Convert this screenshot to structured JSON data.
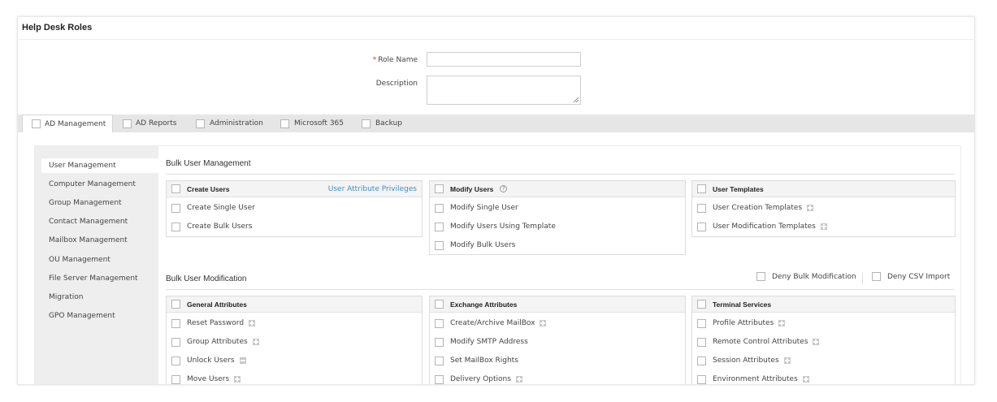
{
  "title": "Help Desk Roles",
  "form": {
    "role_name_required_mark": "*",
    "role_name_label": "Role Name",
    "role_name_value": "",
    "description_label": "Description",
    "description_value": ""
  },
  "tabs": [
    {
      "label": "AD Management",
      "active": true
    },
    {
      "label": "AD Reports",
      "active": false
    },
    {
      "label": "Administration",
      "active": false
    },
    {
      "label": "Microsoft 365",
      "active": false
    },
    {
      "label": "Backup",
      "active": false
    }
  ],
  "sidebar": {
    "items": [
      {
        "label": "User Management",
        "active": true
      },
      {
        "label": "Computer Management",
        "active": false
      },
      {
        "label": "Group Management",
        "active": false
      },
      {
        "label": "Contact Management",
        "active": false
      },
      {
        "label": "Mailbox Management",
        "active": false
      },
      {
        "label": "OU Management",
        "active": false
      },
      {
        "label": "File Server Management",
        "active": false
      },
      {
        "label": "Migration",
        "active": false
      },
      {
        "label": "GPO Management",
        "active": false
      }
    ]
  },
  "bulk_user_management": {
    "title": "Bulk User Management",
    "create_users": {
      "header": "Create Users",
      "link": "User Attribute Privileges",
      "rows": [
        "Create Single User",
        "Create Bulk Users"
      ]
    },
    "modify_users": {
      "header": "Modify Users",
      "help_icon": "?",
      "rows": [
        "Modify Single User",
        "Modify Users Using Template",
        "Modify Bulk Users"
      ]
    },
    "user_templates": {
      "header": "User Templates",
      "rows": [
        "User Creation Templates",
        "User Modification Templates"
      ]
    }
  },
  "bulk_user_modification": {
    "title": "Bulk User Modification",
    "deny_bulk_label": "Deny Bulk Modification",
    "deny_csv_label": "Deny CSV Import",
    "general_attributes": {
      "header": "General Attributes",
      "rows": [
        "Reset Password",
        "Group Attributes",
        "Unlock Users",
        "Move Users"
      ]
    },
    "exchange_attributes": {
      "header": "Exchange Attributes",
      "rows": [
        "Create/Archive MailBox",
        "Modify SMTP Address",
        "Set MailBox Rights",
        "Delivery Options"
      ]
    },
    "terminal_services": {
      "header": "Terminal Services",
      "rows": [
        "Profile Attributes",
        "Remote Control Attributes",
        "Session Attributes",
        "Environment Attributes"
      ]
    }
  },
  "colors": {
    "link": "#3d8fc9",
    "required": "#e0302a",
    "sidebar_bg": "#eeeeee",
    "tabbar_bg": "#e6e6e6"
  }
}
